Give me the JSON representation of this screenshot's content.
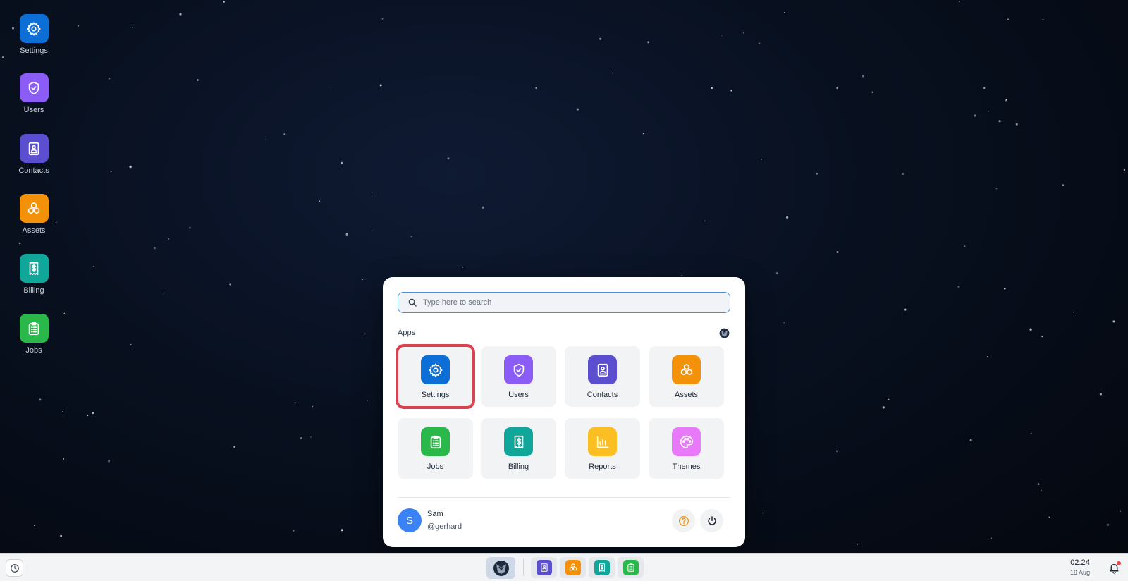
{
  "colors": {
    "settings": "#0d6fd6",
    "users": "#8b5cf6",
    "contacts": "#5b4fcf",
    "assets": "#f39208",
    "billing": "#11a69a",
    "jobs": "#2bb84a",
    "reports": "#fbbf24",
    "themes": "#e879f9",
    "selection": "#d9434f",
    "avatar": "#3b82f6",
    "notification_dot": "#ef4444"
  },
  "desktop": {
    "icons": [
      {
        "label": "Settings",
        "icon": "gear-icon",
        "color": "#0d6fd6"
      },
      {
        "label": "Users",
        "icon": "shield-check-icon",
        "color": "#8b5cf6"
      },
      {
        "label": "Contacts",
        "icon": "contact-book-icon",
        "color": "#5b4fcf"
      },
      {
        "label": "Assets",
        "icon": "cubes-icon",
        "color": "#f39208"
      },
      {
        "label": "Billing",
        "icon": "receipt-dollar-icon",
        "color": "#11a69a"
      },
      {
        "label": "Jobs",
        "icon": "clipboard-list-icon",
        "color": "#2bb84a"
      }
    ]
  },
  "launcher": {
    "search": {
      "placeholder": "Type here to search",
      "value": ""
    },
    "apps_heading": "Apps",
    "selected_app": "Settings",
    "apps": [
      {
        "label": "Settings",
        "icon": "gear-icon",
        "color": "#0d6fd6"
      },
      {
        "label": "Users",
        "icon": "shield-check-icon",
        "color": "#8b5cf6"
      },
      {
        "label": "Contacts",
        "icon": "contact-book-icon",
        "color": "#5b4fcf"
      },
      {
        "label": "Assets",
        "icon": "cubes-icon",
        "color": "#f39208"
      },
      {
        "label": "Jobs",
        "icon": "clipboard-list-icon",
        "color": "#2bb84a"
      },
      {
        "label": "Billing",
        "icon": "receipt-dollar-icon",
        "color": "#11a69a"
      },
      {
        "label": "Reports",
        "icon": "bar-chart-icon",
        "color": "#fbbf24"
      },
      {
        "label": "Themes",
        "icon": "palette-icon",
        "color": "#e879f9"
      }
    ],
    "user": {
      "initial": "S",
      "name": "Sam",
      "handle": "@gerhard"
    }
  },
  "taskbar": {
    "pinned": [
      {
        "name": "contacts",
        "icon": "contact-book-icon",
        "color": "#5b4fcf"
      },
      {
        "name": "assets",
        "icon": "cubes-icon",
        "color": "#f39208"
      },
      {
        "name": "billing",
        "icon": "receipt-dollar-icon",
        "color": "#11a69a"
      },
      {
        "name": "jobs",
        "icon": "clipboard-list-icon",
        "color": "#2bb84a"
      }
    ],
    "time": "02:24",
    "date": "19 Aug"
  }
}
